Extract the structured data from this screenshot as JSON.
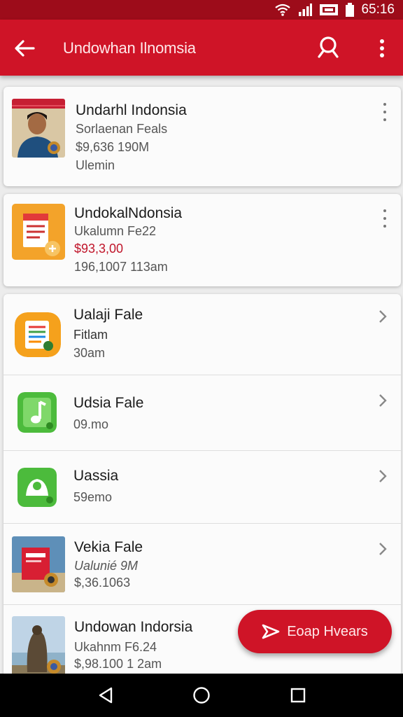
{
  "status_bar": {
    "time": "65:16"
  },
  "app_bar": {
    "title": "Undowhan Ilnomsia"
  },
  "cards": [
    {
      "title": "Undarhl Indonsia",
      "subtitle": "Sorlaenan Feals",
      "line3": "$9,636 190M",
      "line4": "Ulemin"
    },
    {
      "title": "UndokalNdonsia",
      "subtitle": "Ukalumn Fe22",
      "price": "$93,3,00",
      "line4": "196,1007 113am"
    }
  ],
  "rows": [
    {
      "title": "Ualaji Fale",
      "subtitle": "Fitlam",
      "line3": "30am",
      "icon": "notes-app-icon"
    },
    {
      "title": "Udsia Fale",
      "subtitle": "09.mo",
      "icon": "music-app-icon"
    },
    {
      "title": "Uassia",
      "subtitle": "59emo",
      "icon": "map-app-icon"
    },
    {
      "title": "Vekia Fale",
      "subtitle": "Ualunié 9M",
      "line3": "$,36.1063",
      "icon": "book-image"
    },
    {
      "title": "Undowan Indorsia",
      "subtitle": "Ukahnm F6.24",
      "line3": "$,98.100 1 2am",
      "icon": "statue-image"
    }
  ],
  "fab": {
    "label": "Eoap Hvears"
  },
  "colors": {
    "primary": "#cf1427",
    "status_bar": "#9d0c1a",
    "accent_text": "#c0152a"
  }
}
